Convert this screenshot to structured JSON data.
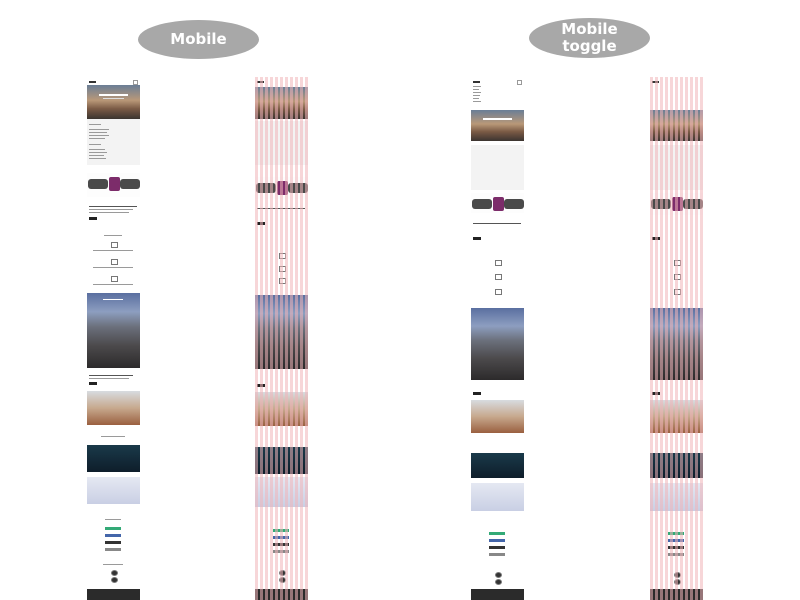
{
  "labels": {
    "mobile": "Mobile",
    "mobile_toggle_line1": "Mobile",
    "mobile_toggle_line2": "toggle"
  },
  "colors": {
    "label_pill": "#a8a8a8",
    "grid_overlay": "#f0b4b9",
    "footer": "#2b2b2b"
  }
}
